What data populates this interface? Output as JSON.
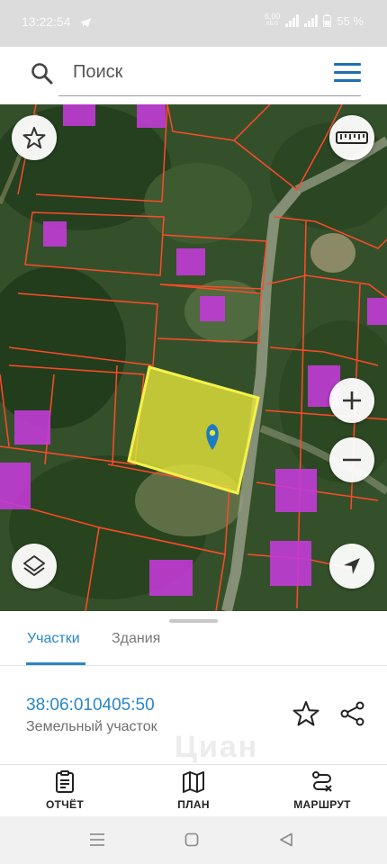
{
  "status_bar": {
    "time": "13:22:54",
    "net_speed_value": "6,00",
    "net_speed_unit": "КБ/S",
    "battery": "55 %"
  },
  "search": {
    "placeholder": "Поиск"
  },
  "map": {
    "selected_parcel_color": "#e8e83a",
    "parcel_border_color": "#ff4a2a",
    "building_color": "#c23bd6",
    "marker_color": "#1d7bc4"
  },
  "sheet": {
    "tabs": [
      {
        "label": "Участки",
        "active": true
      },
      {
        "label": "Здания",
        "active": false
      }
    ],
    "parcel": {
      "cadastral_number": "38:06:010405:50",
      "type": "Земельный участок"
    },
    "watermark": "Циан"
  },
  "bottom_nav": [
    {
      "label": "ОТЧЁТ",
      "icon": "report-icon"
    },
    {
      "label": "ПЛАН",
      "icon": "map-plan-icon"
    },
    {
      "label": "МАРШРУТ",
      "icon": "route-icon"
    }
  ],
  "colors": {
    "accent": "#2a86c7",
    "menu": "#1f6fb5"
  }
}
